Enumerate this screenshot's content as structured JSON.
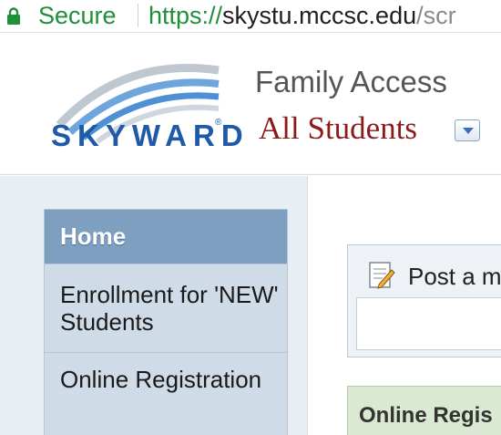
{
  "browser": {
    "security_label": "Secure",
    "url_scheme": "https://",
    "url_host": "skystu.mccsc.edu",
    "url_path": "/scr"
  },
  "header": {
    "logo_text": "SKYWARD",
    "logo_reg": "®",
    "app_title": "Family Access",
    "student_selector": "All Students"
  },
  "sidebar": {
    "items": [
      {
        "label": "Home"
      },
      {
        "label": "Enrollment for 'NEW' Students"
      },
      {
        "label": "Online Registration"
      }
    ]
  },
  "main": {
    "post_label": "Post a m",
    "registration_label": "Online Regis"
  },
  "colors": {
    "secure_green": "#1f8f3a",
    "skyward_blue": "#1f5aa8",
    "student_red": "#8b1a1a",
    "nav_active": "#7f9fc0"
  }
}
